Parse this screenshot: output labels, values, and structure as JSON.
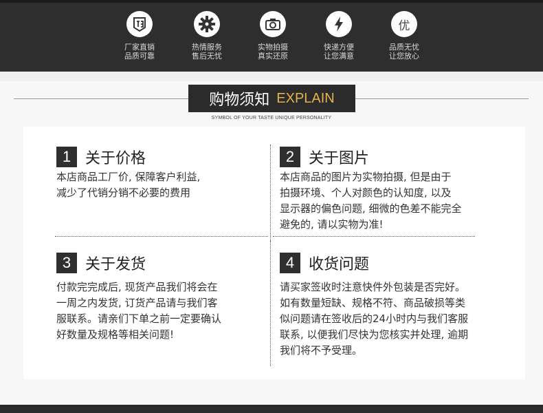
{
  "features": [
    {
      "icon": "factory-badge-icon",
      "line1": "厂家直销",
      "line2": "品质可靠"
    },
    {
      "icon": "gear-icon",
      "line1": "热情服务",
      "line2": "售后无忧"
    },
    {
      "icon": "camera-icon",
      "line1": "实物拍摄",
      "line2": "真实还原"
    },
    {
      "icon": "lightning-icon",
      "line1": "快递方便",
      "line2": "让您满意"
    },
    {
      "icon": "quality-char-icon",
      "glyph": "优",
      "line1": "品质无忧",
      "line2": "让您放心"
    }
  ],
  "title": {
    "cn": "购物须知",
    "en": "EXPLAIN",
    "subtitle": "SYMBOL OF YOUR TASTE UNIQUE PERSONALITY"
  },
  "sections": [
    {
      "num": "1",
      "heading": "关于价格",
      "lines": [
        "本店商品工厂价, 保障客户利益,",
        "减少了代销分销不必要的费用"
      ]
    },
    {
      "num": "2",
      "heading": "关于图片",
      "lines": [
        "本店商品的图片为实物拍摄, 但是由于",
        "拍摄环境、个人对颜色的认知度, 以及",
        "显示器的偏色问题, 细微的色差不能完全",
        "避免的, 请以实物为准!"
      ]
    },
    {
      "num": "3",
      "heading": "关于发货",
      "lines": [
        "付款完完成后, 现货产品我们将会在",
        "一周之内发货, 订货产品请与我们客",
        "服联系。请亲们下单之前一定要确认",
        "好数量及规格等相关问题!"
      ]
    },
    {
      "num": "4",
      "heading": "收货问题",
      "lines": [
        "请买家签收时注意快件外包装是否完好。",
        "如有数量短缺、规格不符、商品破损等类",
        "似问题请在签收后的24小时内与我们客服",
        "联系, 以便我们尽快为您核实并处理, 逾期",
        "我们将不予受理。"
      ]
    }
  ]
}
